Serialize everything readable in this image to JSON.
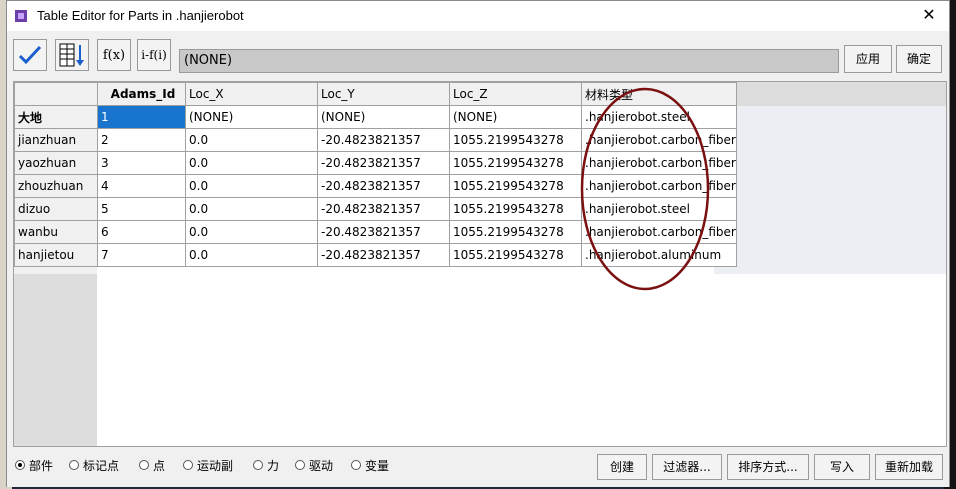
{
  "window": {
    "title": "Table Editor for Parts in .hanjierobot"
  },
  "toolbar": {
    "formula_value": "(NONE)",
    "apply_label": "应用",
    "ok_label": "确定",
    "fx_label": "f(x)",
    "fi_label": "i-f(i)"
  },
  "table": {
    "columns": [
      "Adams_Id",
      "Loc_X",
      "Loc_Y",
      "Loc_Z",
      "材料类型"
    ],
    "rows": [
      {
        "name": "大地",
        "cells": [
          "1",
          "(NONE)",
          "(NONE)",
          "(NONE)",
          ".hanjierobot.steel"
        ]
      },
      {
        "name": "jianzhuan",
        "cells": [
          "2",
          "0.0",
          "-20.4823821357",
          "1055.2199543278",
          ".hanjierobot.carbon_fiber"
        ]
      },
      {
        "name": "yaozhuan",
        "cells": [
          "3",
          "0.0",
          "-20.4823821357",
          "1055.2199543278",
          ".hanjierobot.carbon_fiber"
        ]
      },
      {
        "name": "zhouzhuan",
        "cells": [
          "4",
          "0.0",
          "-20.4823821357",
          "1055.2199543278",
          ".hanjierobot.carbon_fiber"
        ]
      },
      {
        "name": "dizuo",
        "cells": [
          "5",
          "0.0",
          "-20.4823821357",
          "1055.2199543278",
          ".hanjierobot.steel"
        ]
      },
      {
        "name": "wanbu",
        "cells": [
          "6",
          "0.0",
          "-20.4823821357",
          "1055.2199543278",
          ".hanjierobot.carbon_fiber"
        ]
      },
      {
        "name": "hanjietou",
        "cells": [
          "7",
          "0.0",
          "-20.4823821357",
          "1055.2199543278",
          ".hanjierobot.aluminum"
        ]
      }
    ]
  },
  "bottom": {
    "radios": [
      {
        "label": "部件",
        "selected": true
      },
      {
        "label": "标记点",
        "selected": false
      },
      {
        "label": "点",
        "selected": false
      },
      {
        "label": "运动副",
        "selected": false
      },
      {
        "label": "力",
        "selected": false
      },
      {
        "label": "驱动",
        "selected": false
      },
      {
        "label": "变量",
        "selected": false
      }
    ],
    "buttons": [
      "创建",
      "过滤器...",
      "排序方式...",
      "写入",
      "重新加载"
    ]
  },
  "colors": {
    "selection": "#1874cd",
    "annotation_circle": "#7a1010",
    "checkmark": "#1b5fcc"
  }
}
